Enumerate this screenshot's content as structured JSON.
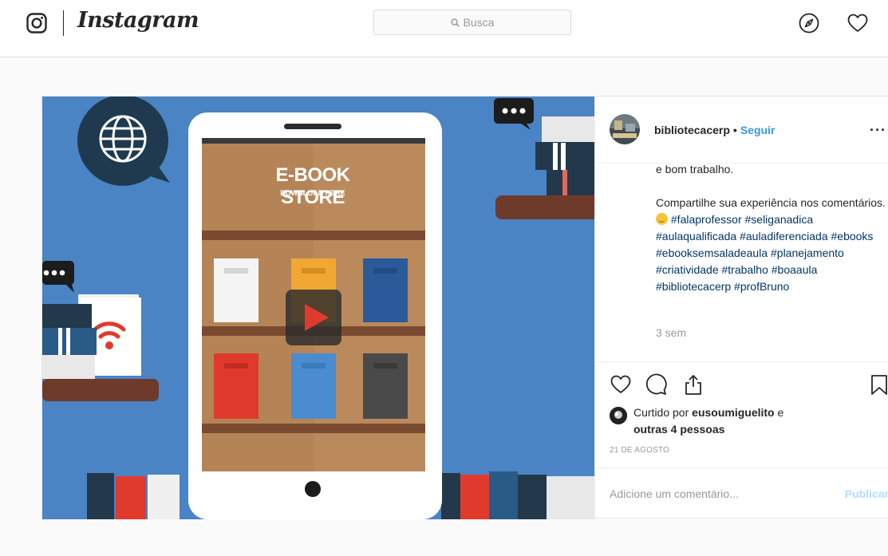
{
  "nav": {
    "brand": "Instagram",
    "search_placeholder": "Busca"
  },
  "post": {
    "image_text": {
      "title": "E-BOOK STORE",
      "subtitle": "DOWNLOAD HERE"
    },
    "username": "bibliotecacerp",
    "separator": "•",
    "follow_label": "Seguir",
    "more_label": "···",
    "caption_prev_line": "e bom trabalho.",
    "caption_text": "Compartilhe sua experiência nos comentários.",
    "hashtags": "#falaprofessor #seliganadica #aulaqualificada #auladiferenciada #ebooks #ebooksemsaladeaula #planejamento #criatividade #trabalho #boaaula #bibliotecacerp #profBruno",
    "time_ago": "3 sem",
    "likes_prefix": "Curtido por",
    "likes_user": "eusoumiguelito",
    "likes_and": "e",
    "likes_others": "outras 4 pessoas",
    "date": "21 DE AGOSTO",
    "comment_placeholder": "Adicione um comentário...",
    "publish_label": "Publicar"
  },
  "colors": {
    "link_blue": "#3897f0",
    "hashtag_blue": "#003569",
    "scene_bg": "#4a84c4",
    "shelf_wood": "#b48457",
    "play_red": "#e03a2d"
  },
  "icons": [
    "instagram-glyph-icon",
    "search-icon",
    "compass-icon",
    "heart-icon",
    "comment-icon",
    "share-icon",
    "bookmark-icon",
    "play-icon",
    "globe-icon",
    "wifi-icon"
  ]
}
